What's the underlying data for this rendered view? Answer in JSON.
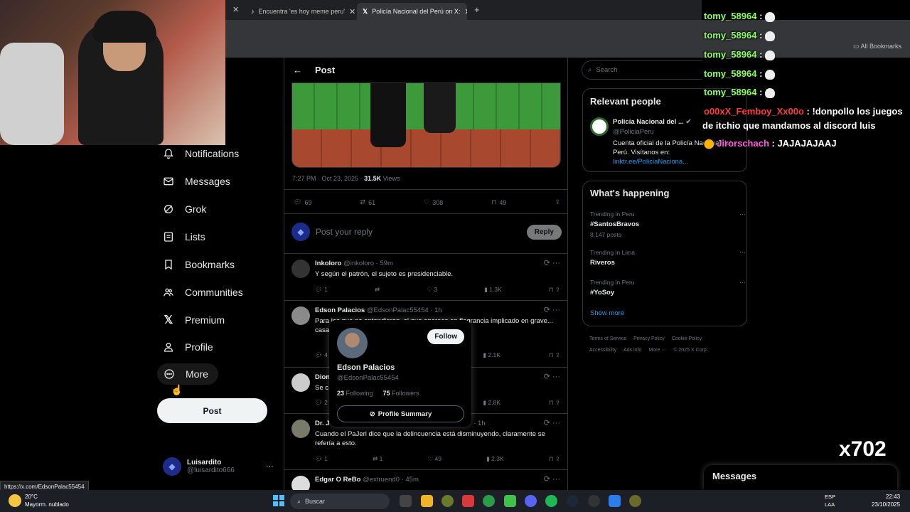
{
  "browser": {
    "tabs": [
      {
        "label": "Encuentra 'es hoy meme peru'",
        "icon": "tiktok-icon"
      },
      {
        "label": "Policía Nacional del Perú on X:",
        "icon": "x-logo-icon"
      }
    ],
    "bookmarks_label": "All Bookmarks"
  },
  "nav": {
    "items": [
      {
        "label": "Notifications",
        "icon": "bell-icon"
      },
      {
        "label": "Messages",
        "icon": "envelope-icon"
      },
      {
        "label": "Grok",
        "icon": "grok-icon"
      },
      {
        "label": "Lists",
        "icon": "list-icon"
      },
      {
        "label": "Bookmarks",
        "icon": "bookmark-icon"
      },
      {
        "label": "Communities",
        "icon": "communities-icon"
      },
      {
        "label": "Premium",
        "icon": "x-logo-icon"
      },
      {
        "label": "Profile",
        "icon": "person-icon"
      },
      {
        "label": "More",
        "icon": "more-circle-icon"
      }
    ],
    "post_button": "Post",
    "account": {
      "name": "Luisardito",
      "handle": "@luisardito666"
    }
  },
  "post": {
    "header": "Post",
    "time": "7:27 PM · Oct 23, 2025 · ",
    "views_count": "31.5K",
    "views_label": " Views",
    "stats": {
      "replies": "69",
      "reposts": "61",
      "likes": "308",
      "bookmarks": "49"
    },
    "reply_placeholder": "Post your reply",
    "reply_button": "Reply"
  },
  "comments": [
    {
      "name": "Inkoloro",
      "meta": "@inkoloro · 59m",
      "text": "Y según el patrón, el sujeto es presidenciable.",
      "replies": "1",
      "reposts": "",
      "likes": "3",
      "views": "1.3K"
    },
    {
      "name": "Edson Palacios",
      "meta": "@EdsonPalac55454 · 1h",
      "text": "Para los que no entendieron, el que aparece en flagrancia implicado en grave... casaca verde limón con gorra...",
      "replies": "4",
      "reposts": "",
      "likes": "",
      "views": "2.1K"
    },
    {
      "name": "Dion",
      "meta": "",
      "text": "Se c... es.",
      "replies": "2",
      "reposts": "",
      "likes": "",
      "views": "2.8K"
    },
    {
      "name": "Dr. J",
      "meta": "· 1h",
      "text": "Cuando el PaJeri dice que la delincuencia está disminuyendo, claramente se refería a esto.",
      "replies": "1",
      "reposts": "1",
      "likes": "49",
      "views": "2.3K"
    },
    {
      "name": "Edgar O ReBo",
      "meta": "@extruend0 · 45m",
      "text": "",
      "replies": "",
      "reposts": "",
      "likes": "",
      "views": ""
    }
  ],
  "hovercard": {
    "name": "Edson Palacios",
    "handle": "@EdsonPalac55454",
    "following_count": "23",
    "following_label": " Following",
    "followers_count": "75",
    "followers_label": " Followers",
    "follow_button": "Follow",
    "summary_button": "Profile Summary"
  },
  "sidebar": {
    "search_placeholder": "Search",
    "relevant_title": "Relevant people",
    "relevant_person": {
      "name": "Policía Nacional del ...",
      "handle": "@PoliciaPeru",
      "bio": "Cuenta oficial de la Policía Nacional del Perú. Visítanos en:",
      "link": "linktr.ee/PoliciaNaciona..."
    },
    "happening_title": "What's happening",
    "trends": [
      {
        "context": "Trending in Peru",
        "name": "#SantosBravos",
        "count": "8,147 posts"
      },
      {
        "context": "Trending in Lima",
        "name": "Riveros",
        "count": ""
      },
      {
        "context": "Trending in Peru",
        "name": "#YoSoy",
        "count": ""
      }
    ],
    "show_more": "Show more",
    "footer": [
      "Terms of Service",
      "Privacy Policy",
      "Cookie Policy",
      "Accessibility",
      "Ads info",
      "More ···",
      "© 2025 X Corp."
    ]
  },
  "chat": [
    {
      "user": "tomy_58964",
      "msg": ""
    },
    {
      "user": "tomy_58964",
      "msg": ""
    },
    {
      "user": "tomy_58964",
      "msg": ""
    },
    {
      "user": "tomy_58964",
      "msg": ""
    },
    {
      "user": "tomy_58964",
      "msg": ""
    },
    {
      "user": "o00xX_Femboy_Xx00o",
      "msg": "!donpollo los juegos"
    },
    {
      "user": "",
      "msg": "de itchio que mandamos al discord luis"
    },
    {
      "user": "Jirorschach",
      "msg": "JAJAJAJAAJ"
    }
  ],
  "messages_panel": "Messages",
  "watermark": "x702",
  "status_url": "https://x.com/EdsonPalac55454",
  "taskbar": {
    "temp": "20°C",
    "weather": "Mayorm. nublado",
    "search": "Buscar",
    "lang": "ESP",
    "lang2": "LAA",
    "time": "22:43",
    "date": "23/10/2025"
  }
}
